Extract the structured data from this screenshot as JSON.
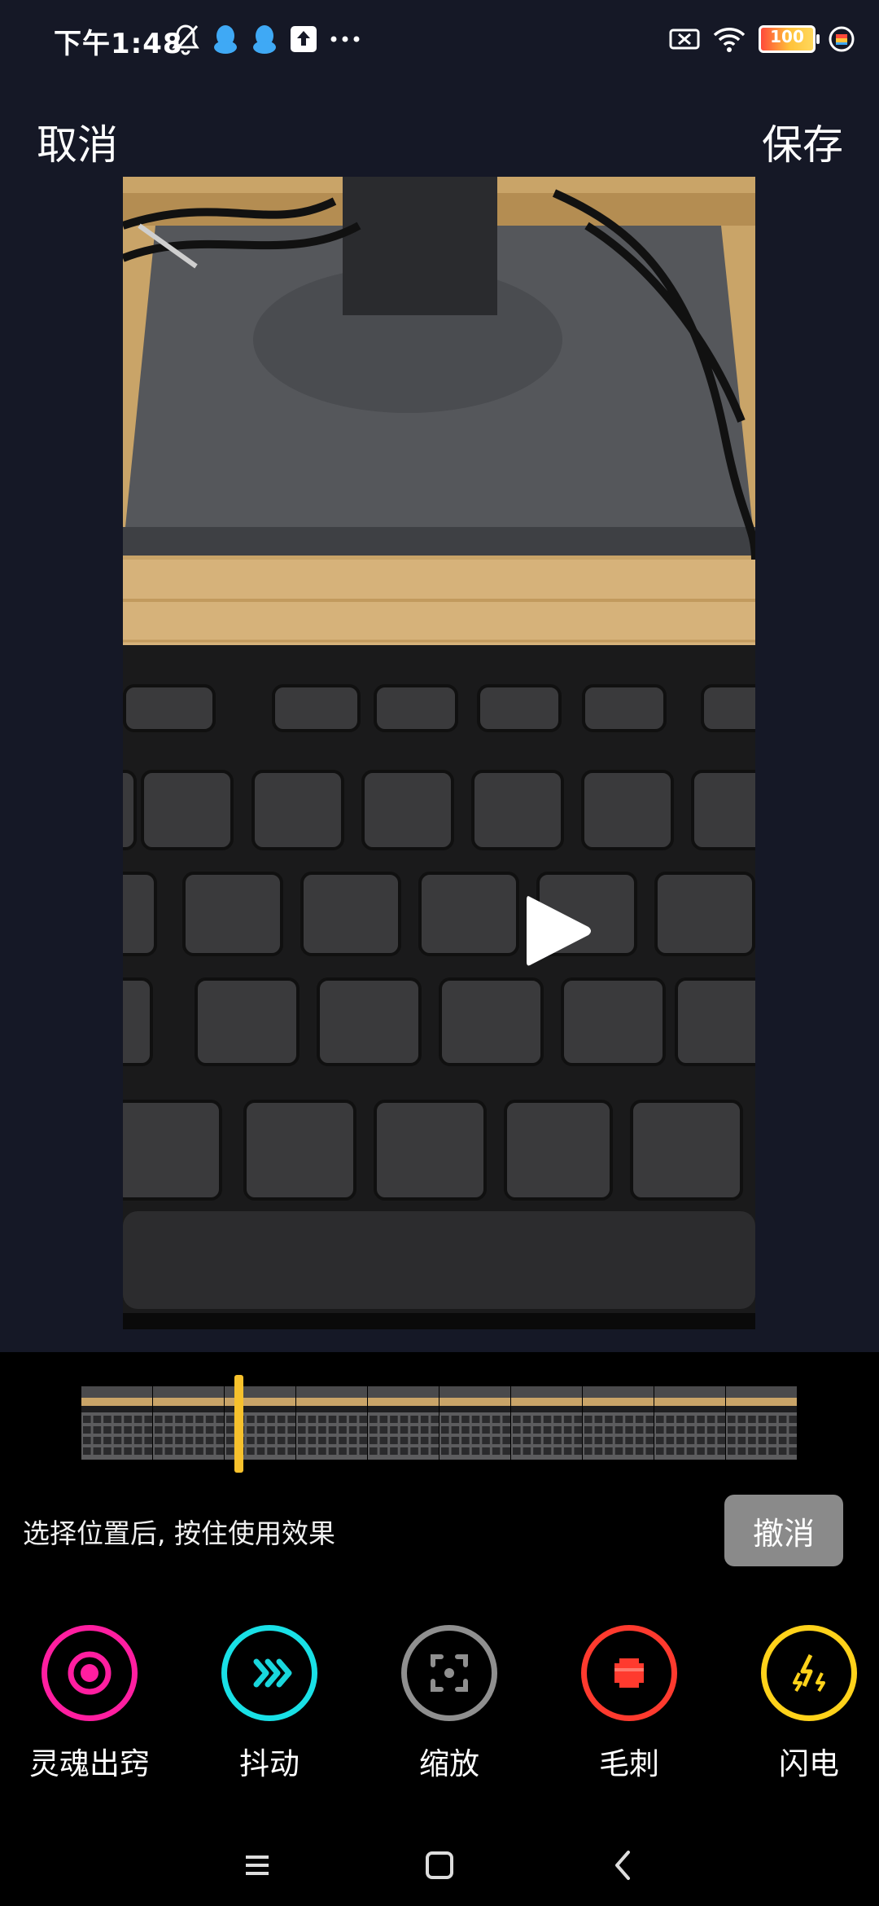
{
  "status_bar": {
    "time": "下午1:48",
    "battery": "100",
    "icons": [
      "bell-off-icon",
      "qq-icon",
      "qq-icon",
      "upload-icon",
      "more-dots-icon",
      "sim-off-icon",
      "wifi-icon",
      "battery-icon",
      "app-badge-icon"
    ]
  },
  "header": {
    "cancel_label": "取消",
    "save_label": "保存"
  },
  "video": {
    "play_icon": "play-icon"
  },
  "timeline": {
    "frame_count": 10,
    "playhead_color": "#f7c12c"
  },
  "hint_text": "选择位置后, 按住使用效果",
  "undo_label": "撤消",
  "effects": [
    {
      "label": "灵魂出窍",
      "color": "#ff1ea0",
      "icon": "soul-icon"
    },
    {
      "label": "抖动",
      "color": "#19e0e6",
      "icon": "shake-icon"
    },
    {
      "label": "缩放",
      "color": "#8f8f8f",
      "icon": "zoom-icon"
    },
    {
      "label": "毛刺",
      "color": "#ff3a2e",
      "icon": "glitch-icon"
    },
    {
      "label": "闪电",
      "color": "#ffd21a",
      "icon": "lightning-icon"
    }
  ],
  "nav": [
    "menu-icon",
    "home-icon",
    "back-icon"
  ]
}
